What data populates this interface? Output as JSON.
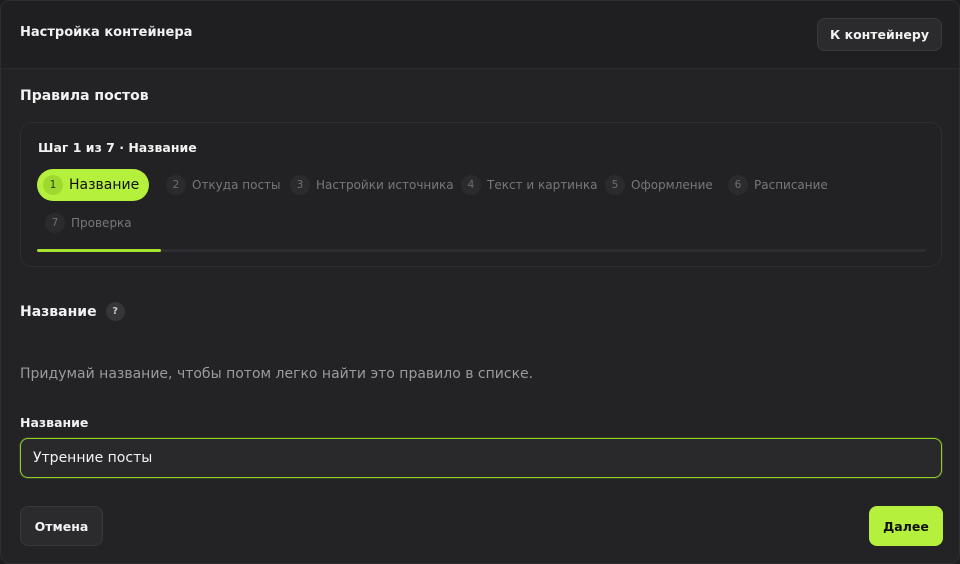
{
  "header": {
    "title": "Настройка контейнера",
    "back_button": "К контейнеру"
  },
  "section_title": "Правила постов",
  "wizard": {
    "caption": "Шаг 1 из 7 · Название",
    "current_step": 1,
    "total_steps": 7,
    "progress_fraction": 0.14,
    "steps": [
      {
        "num": "1",
        "label": "Название"
      },
      {
        "num": "2",
        "label": "Откуда посты"
      },
      {
        "num": "3",
        "label": "Настройки источника"
      },
      {
        "num": "4",
        "label": "Текст и картинка"
      },
      {
        "num": "5",
        "label": "Оформление"
      },
      {
        "num": "6",
        "label": "Расписание"
      },
      {
        "num": "7",
        "label": "Проверка"
      }
    ]
  },
  "field": {
    "heading": "Название",
    "help_icon": "?",
    "hint": "Придумай название, чтобы потом легко найти это правило в списке.",
    "label": "Название",
    "value": "Утренние посты"
  },
  "footer": {
    "cancel_label": "Отмена",
    "next_label": "Далее"
  },
  "colors": {
    "accent": "#b4f03c",
    "background": "#232325"
  }
}
